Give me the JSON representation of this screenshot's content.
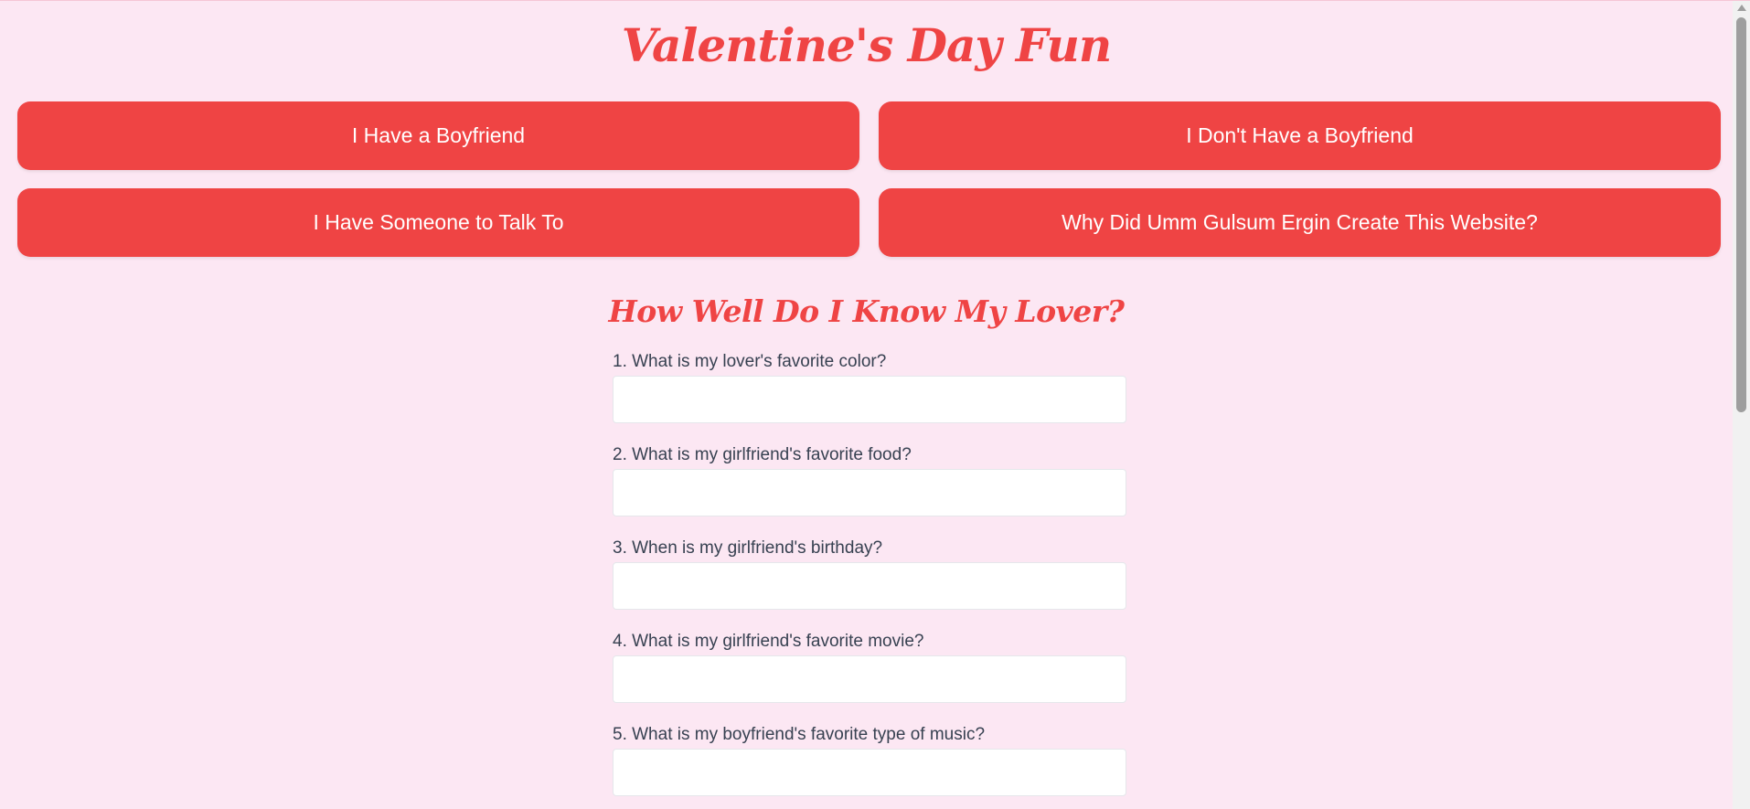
{
  "page": {
    "title": "Valentine's Day Fun"
  },
  "nav_buttons": [
    {
      "label": "I Have a Boyfriend"
    },
    {
      "label": "I Don't Have a Boyfriend"
    },
    {
      "label": "I Have Someone to Talk To"
    },
    {
      "label": "Why Did Umm Gulsum Ergin Create This Website?"
    }
  ],
  "quiz": {
    "title": "How Well Do I Know My Lover?",
    "questions": [
      {
        "label": "1. What is my lover's favorite color?",
        "value": ""
      },
      {
        "label": "2. What is my girlfriend's favorite food?",
        "value": ""
      },
      {
        "label": "3. When is my girlfriend's birthday?",
        "value": ""
      },
      {
        "label": "4. What is my girlfriend's favorite movie?",
        "value": ""
      },
      {
        "label": "5. What is my boyfriend's favorite type of music?",
        "value": ""
      }
    ]
  },
  "colors": {
    "background": "#fce7f3",
    "accent": "#ef4444",
    "button_text": "#ffffff",
    "label_text": "#374151"
  }
}
